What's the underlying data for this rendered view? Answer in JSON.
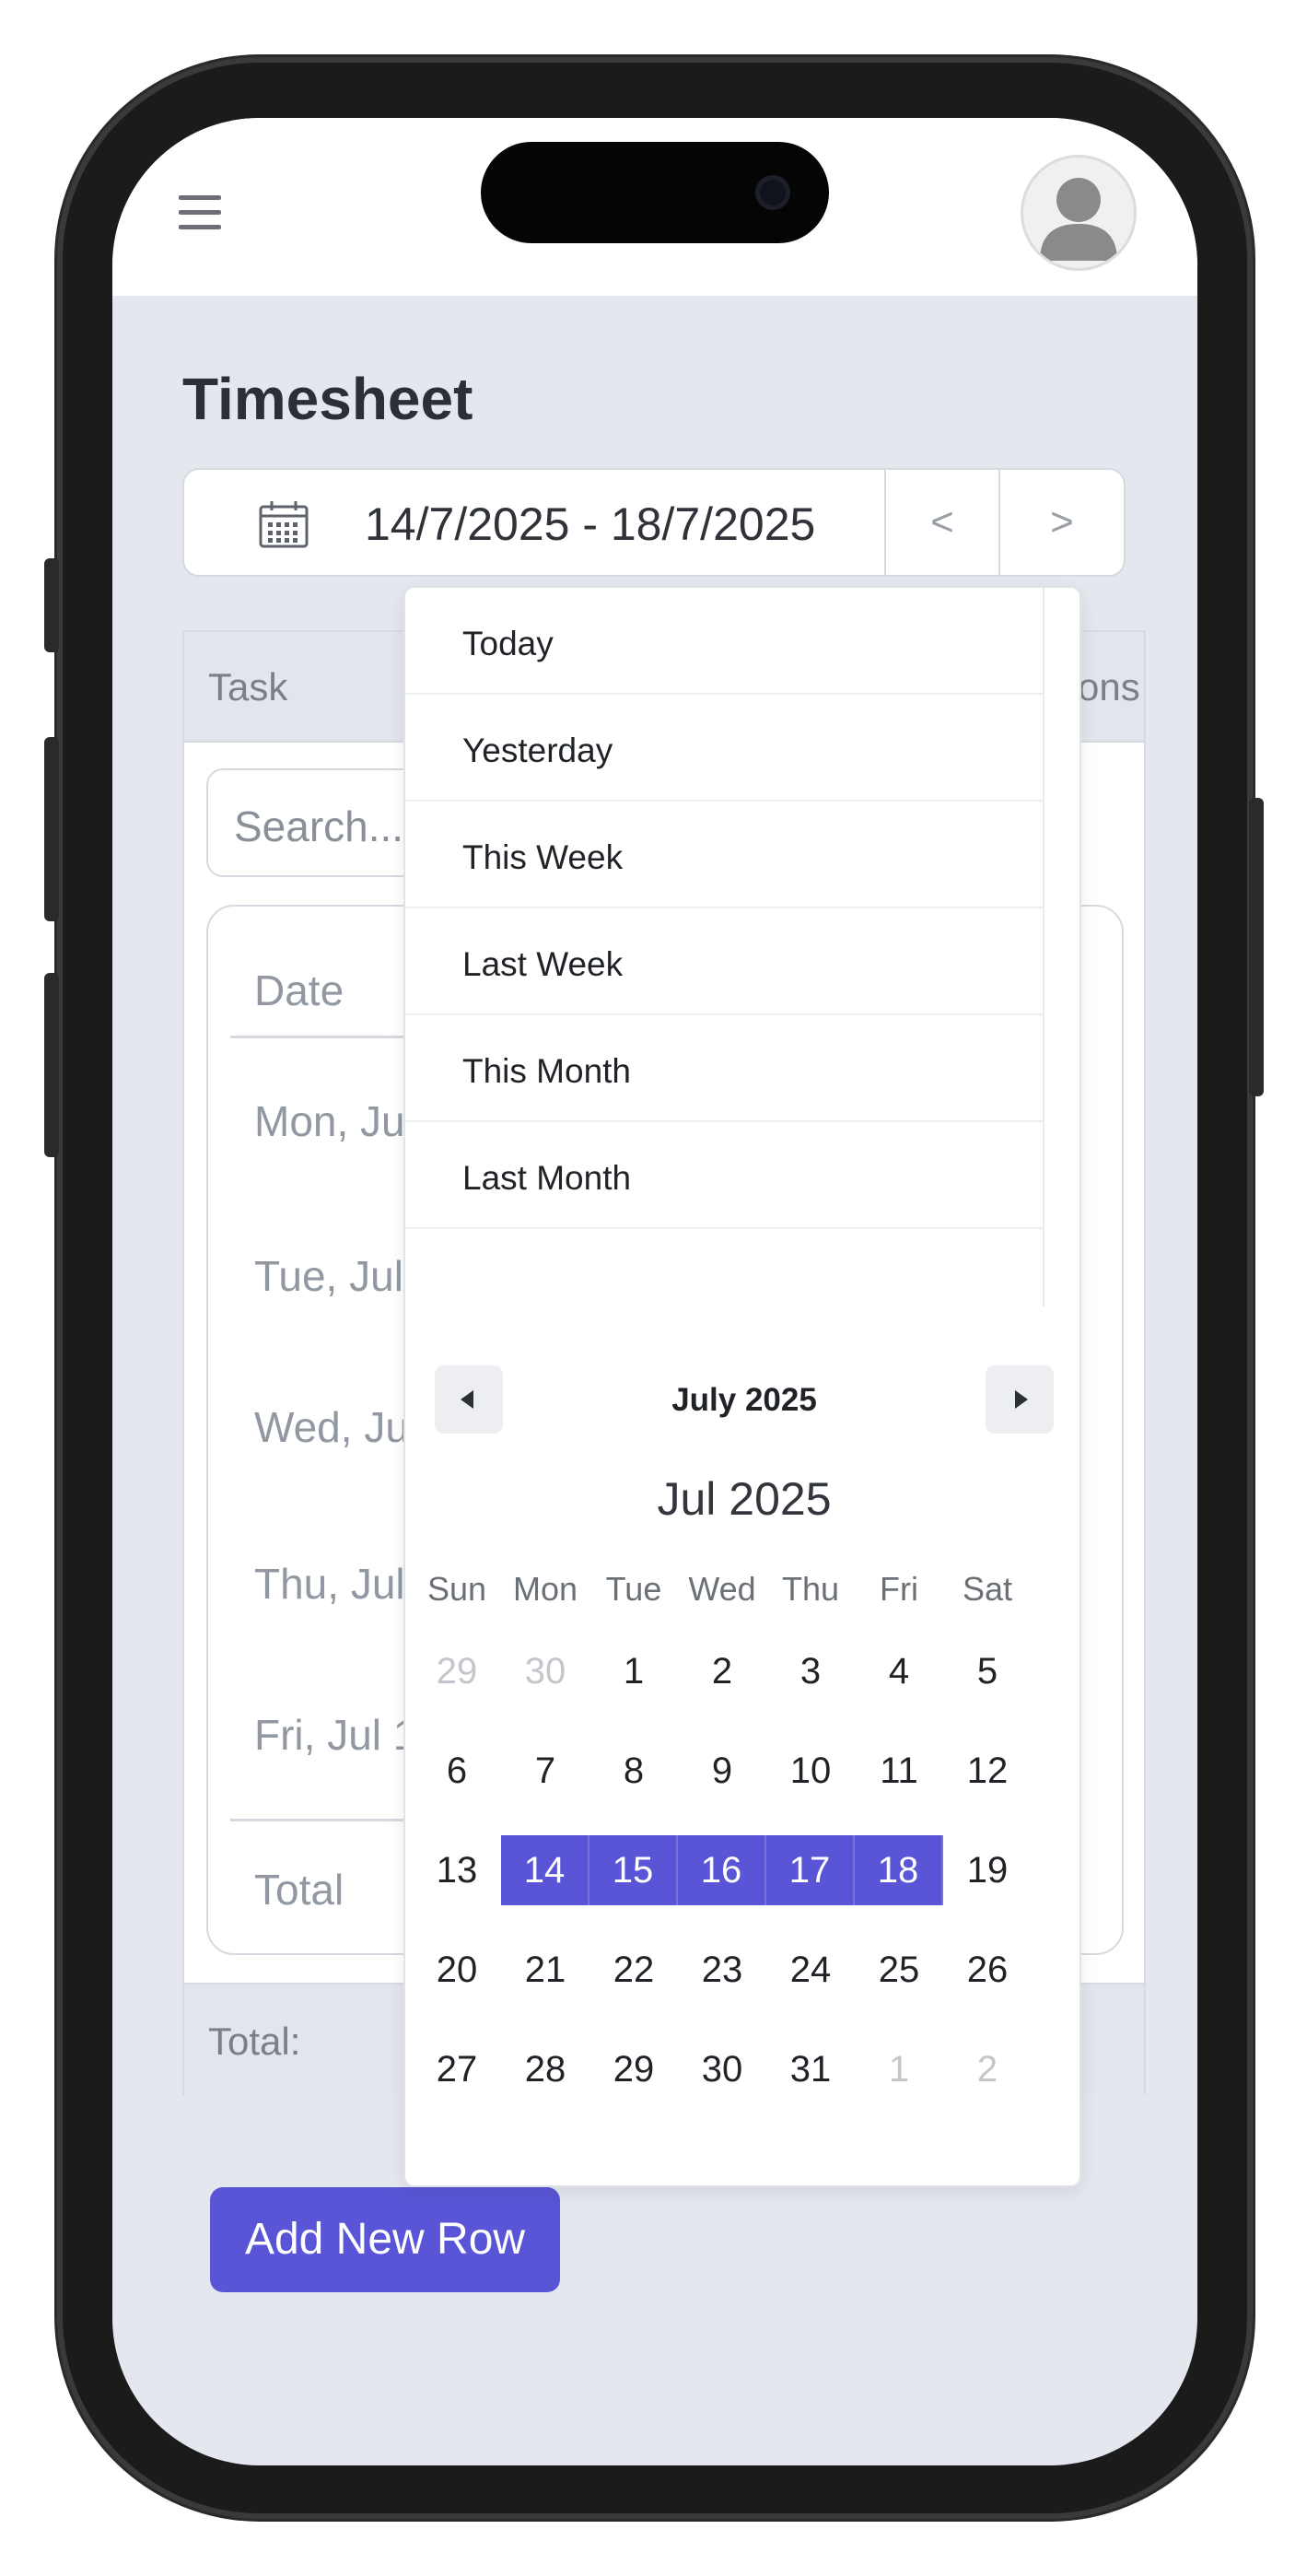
{
  "page": {
    "title": "Timesheet",
    "date_range": "14/7/2025 - 18/7/2025",
    "prev_label": "<",
    "next_label": ">"
  },
  "table": {
    "header_task": "Task",
    "header_actions": "Actions",
    "search_placeholder": "Search...",
    "inner_header_date": "Date",
    "rows": [
      "Mon, Jul 14",
      "Tue, Jul 15",
      "Wed, Jul 16",
      "Thu, Jul 17",
      "Fri, Jul 18"
    ],
    "inner_total": "Total",
    "footer_total": "Total:"
  },
  "add_button": "Add New Row",
  "dropdown": {
    "presets": [
      "Today",
      "Yesterday",
      "This Week",
      "Last Week",
      "This Month",
      "Last Month"
    ],
    "nav_title": "July 2025",
    "month_title": "Jul 2025",
    "weekdays": [
      "Sun",
      "Mon",
      "Tue",
      "Wed",
      "Thu",
      "Fri",
      "Sat"
    ],
    "weeks": [
      [
        "29",
        "30",
        "1",
        "2",
        "3",
        "4",
        "5"
      ],
      [
        "6",
        "7",
        "8",
        "9",
        "10",
        "11",
        "12"
      ],
      [
        "13",
        "14",
        "15",
        "16",
        "17",
        "18",
        "19"
      ],
      [
        "20",
        "21",
        "22",
        "23",
        "24",
        "25",
        "26"
      ],
      [
        "27",
        "28",
        "29",
        "30",
        "31",
        "1",
        "2"
      ]
    ],
    "muted_cells": [
      [
        0,
        0
      ],
      [
        0,
        1
      ],
      [
        4,
        5
      ],
      [
        4,
        6
      ]
    ],
    "selected_cells": [
      [
        2,
        1
      ],
      [
        2,
        2
      ],
      [
        2,
        3
      ],
      [
        2,
        4
      ],
      [
        2,
        5
      ]
    ]
  },
  "colors": {
    "accent": "#5a55d6",
    "background": "#e4e8ee"
  },
  "icons": {
    "menu": "hamburger-menu-icon",
    "calendar": "calendar-icon",
    "avatar": "user-avatar-icon"
  }
}
